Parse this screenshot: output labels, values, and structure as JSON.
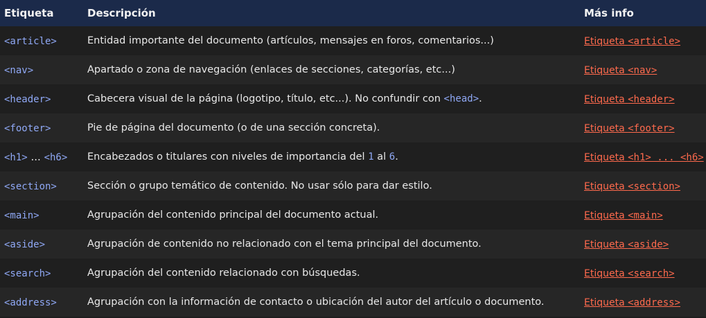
{
  "header": {
    "col1": "Etiqueta",
    "col2": "Descripción",
    "col3": "Más info"
  },
  "rows": [
    {
      "tag": "<article>",
      "desc": "Entidad importante del documento (artículos, mensajes en foros, comentarios...)",
      "link_prefix": "Etiqueta ",
      "link_code": "<article>"
    },
    {
      "tag": "<nav>",
      "desc": "Apartado o zona de navegación (enlaces de secciones, categorías, etc...)",
      "link_prefix": "Etiqueta ",
      "link_code": "<nav>"
    },
    {
      "tag": "<header>",
      "desc_a": "Cabecera visual de la página (logotipo, título, etc...). No confundir con ",
      "desc_code": "<head>",
      "desc_b": ".",
      "link_prefix": "Etiqueta ",
      "link_code": "<header>"
    },
    {
      "tag": "<footer>",
      "desc": "Pie de página del documento (o de una sección concreta).",
      "link_prefix": "Etiqueta ",
      "link_code": "<footer>"
    },
    {
      "tag_a": "<h1>",
      "tag_mid": " ... ",
      "tag_b": "<h6>",
      "desc_a": "Encabezados o titulares con niveles de importancia del ",
      "desc_n1": "1",
      "desc_mid": " al ",
      "desc_n2": "6",
      "desc_b": ".",
      "link_prefix": "Etiqueta ",
      "link_code": "<h1> ... <h6>"
    },
    {
      "tag": "<section>",
      "desc": "Sección o grupo temático de contenido. No usar sólo para dar estilo.",
      "link_prefix": "Etiqueta ",
      "link_code": "<section>"
    },
    {
      "tag": "<main>",
      "desc": "Agrupación del contenido principal del documento actual.",
      "link_prefix": "Etiqueta ",
      "link_code": "<main>"
    },
    {
      "tag": "<aside>",
      "desc": "Agrupación de contenido no relacionado con el tema principal del documento.",
      "link_prefix": "Etiqueta ",
      "link_code": "<aside>"
    },
    {
      "tag": "<search>",
      "desc": "Agrupación del contenido relacionado con búsquedas.",
      "link_prefix": "Etiqueta ",
      "link_code": "<search>"
    },
    {
      "tag": "<address>",
      "desc": "Agrupación con la información de contacto o ubicación del autor del artículo o documento.",
      "link_prefix": "Etiqueta ",
      "link_code": "<address>"
    }
  ],
  "colors": {
    "header_bg": "#1b2a4a",
    "code": "#8fa8f5",
    "link": "#ff6a4d"
  }
}
